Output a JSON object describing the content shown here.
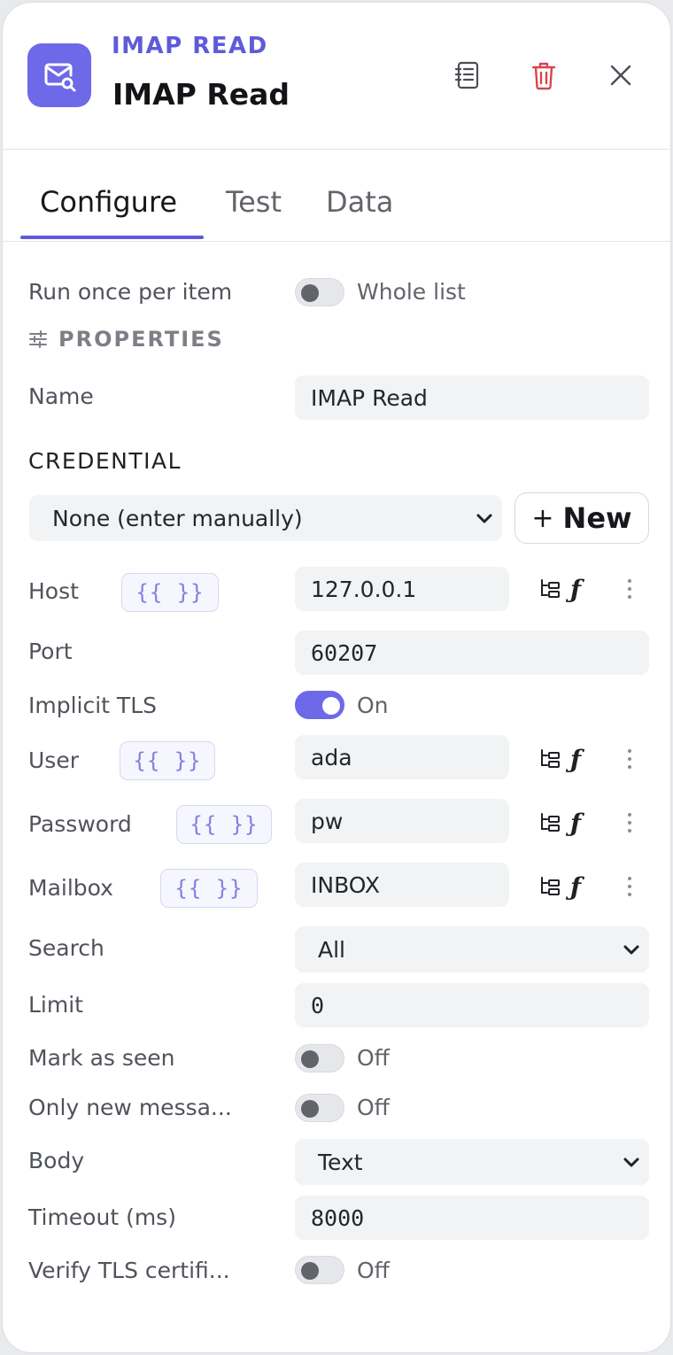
{
  "header": {
    "node_type": "IMAP READ",
    "node_title": "IMAP Read",
    "node_icon": "mail-search-icon",
    "accent_color": "#6d69e8",
    "actions": [
      "notebook-icon",
      "trash-icon",
      "close-icon"
    ]
  },
  "tabs": [
    {
      "label": "Configure",
      "active": true
    },
    {
      "label": "Test",
      "active": false
    },
    {
      "label": "Data",
      "active": false
    }
  ],
  "run_mode": {
    "label": "Run once per item",
    "toggle_text": "Whole list",
    "on": false
  },
  "properties": {
    "heading": "PROPERTIES"
  },
  "name": {
    "label": "Name",
    "value": "IMAP Read"
  },
  "credential": {
    "heading": "CREDENTIAL",
    "selected": "None (enter manually)",
    "new_label": "New",
    "new_plus": "+"
  },
  "template_token": "{{ }}",
  "fields": {
    "host": {
      "label": "Host",
      "value": "127.0.0.1"
    },
    "port": {
      "label": "Port",
      "value": "60207"
    },
    "implicit_tls": {
      "label": "Implicit TLS",
      "toggle_text": "On",
      "on": true
    },
    "user": {
      "label": "User",
      "value": "ada"
    },
    "password": {
      "label": "Password",
      "value": "pw"
    },
    "mailbox": {
      "label": "Mailbox",
      "value": "INBOX"
    },
    "search": {
      "label": "Search",
      "selected": "All"
    },
    "limit": {
      "label": "Limit",
      "value": "0"
    },
    "mark_as_seen": {
      "label": "Mark as seen",
      "toggle_text": "Off",
      "on": false
    },
    "only_new": {
      "label": "Only new messa...",
      "toggle_text": "Off",
      "on": false
    },
    "body": {
      "label": "Body",
      "selected": "Text"
    },
    "timeout": {
      "label": "Timeout (ms)",
      "value": "8000"
    },
    "verify_tls": {
      "label": "Verify TLS certifi...",
      "toggle_text": "Off",
      "on": false
    }
  },
  "field_action_icons": [
    "tree-picker-icon",
    "function-icon",
    "more-vertical-icon"
  ]
}
